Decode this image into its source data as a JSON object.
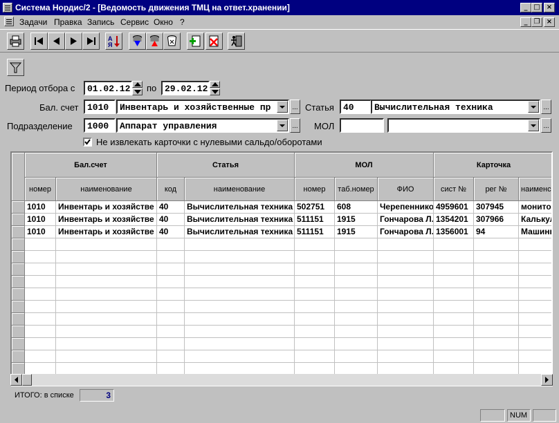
{
  "window": {
    "title": "Система Нордис/2 - [Ведомость движения ТМЦ на ответ.хранении]"
  },
  "menu": {
    "items": [
      "Задачи",
      "Правка",
      "Запись",
      "Сервис",
      "Окно",
      "?"
    ]
  },
  "toolbar": {
    "buttons": [
      "print-icon",
      "first-record-icon",
      "prev-record-icon",
      "next-record-icon",
      "last-record-icon",
      "sort-az-icon",
      "db-down-icon",
      "db-up-icon",
      "db-clear-icon",
      "add-doc-icon",
      "delete-doc-icon",
      "exit-icon"
    ]
  },
  "filter": {
    "period_label": "Период отбора с",
    "date_from": "01.02.12",
    "to_label": "по",
    "date_to": "29.02.12",
    "account_label": "Бал. счет",
    "account_code": "1010",
    "account_name": "Инвентарь и хозяйственные пр",
    "article_label": "Статья",
    "article_code": "40",
    "article_name": "Вычислительная техника",
    "division_label": "Подразделение",
    "division_code": "1000",
    "division_name": "Аппарат управления",
    "mol_label": "МОЛ",
    "mol_code": "",
    "mol_name": "",
    "checkbox_label": "Не извлекать карточки с нулевыми сальдо/оборотами",
    "checkbox_checked": true
  },
  "table": {
    "group_headers": [
      "Бал.счет",
      "Статья",
      "МОЛ",
      "Карточка"
    ],
    "columns": [
      "номер",
      "наименование",
      "код",
      "наименование",
      "номер",
      "таб.номер",
      "ФИО",
      "сист №",
      "рег №",
      "наименс"
    ],
    "rows": [
      [
        "1010",
        "Инвентарь и хозяйстве",
        "40",
        "Вычислительная техника",
        "502751",
        "608",
        "Черепеннико",
        "4959601",
        "307945",
        "монитор"
      ],
      [
        "1010",
        "Инвентарь и хозяйстве",
        "40",
        "Вычислительная техника",
        "511151",
        "1915",
        "Гончарова Л.",
        "1354201",
        "307966",
        "Калькул"
      ],
      [
        "1010",
        "Инвентарь и хозяйстве",
        "40",
        "Вычислительная техника",
        "511151",
        "1915",
        "Гончарова Л.",
        "1356001",
        "94",
        "Машинк"
      ]
    ],
    "empty_rows": 11
  },
  "footer": {
    "total_label": "ИТОГО: в списке",
    "total_value": "3"
  },
  "status": {
    "num_label": "NUM"
  }
}
